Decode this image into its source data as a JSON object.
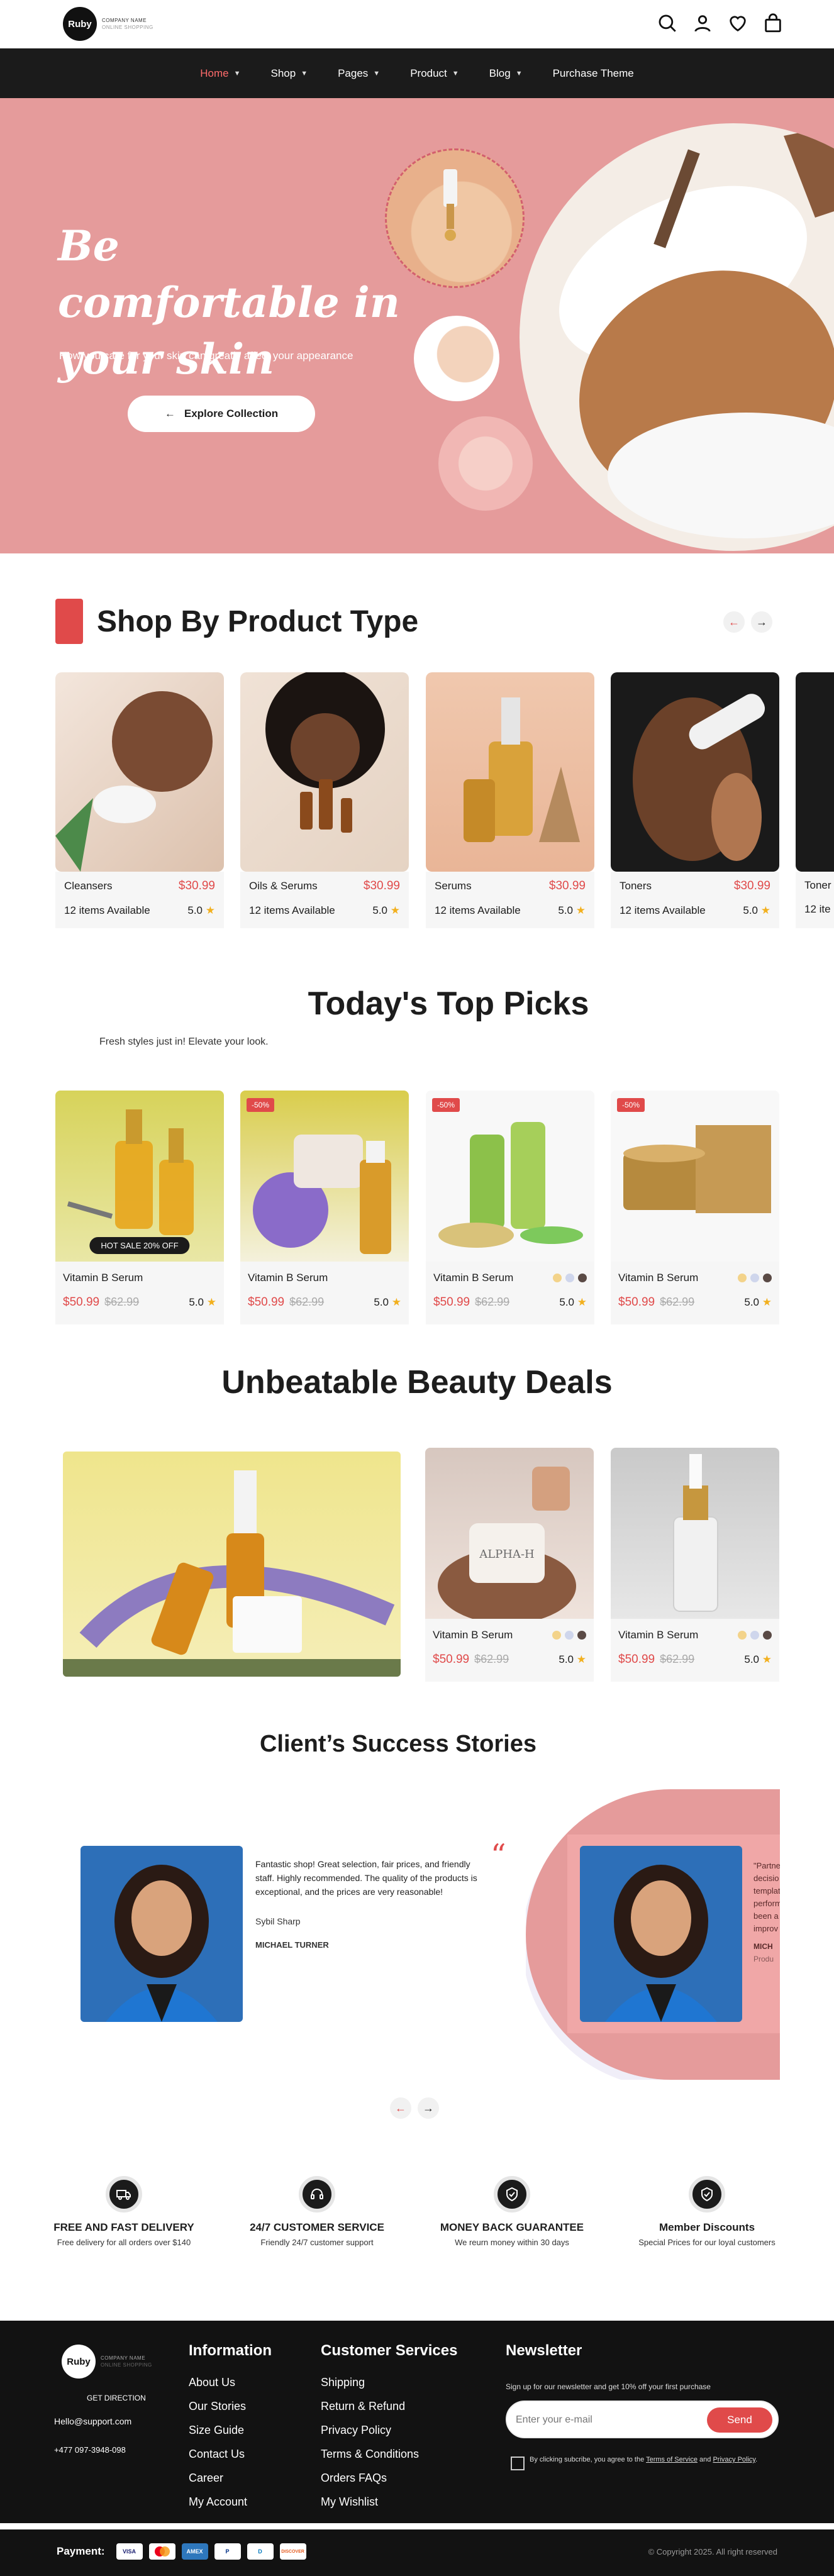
{
  "header": {
    "logo_text": "Ruby",
    "company_name": "COMPANY NAME",
    "company_tag": "ONLINE SHOPPING",
    "icons": [
      "search-icon",
      "user-icon",
      "heart-icon",
      "bag-icon"
    ]
  },
  "nav": {
    "items": [
      {
        "label": "Home",
        "active": true,
        "dropdown": true
      },
      {
        "label": "Shop",
        "dropdown": true
      },
      {
        "label": "Pages",
        "dropdown": true
      },
      {
        "label": "Product",
        "dropdown": true
      },
      {
        "label": "Blog",
        "dropdown": true
      },
      {
        "label": "Purchase Theme",
        "dropdown": false
      }
    ]
  },
  "hero": {
    "title": "Be comfortable in your skin",
    "subtitle": "How you care for your skin can greatly affect your appearance",
    "button": "Explore Collection",
    "bg_color": "#e59b9b"
  },
  "product_types": {
    "title": "Shop By Product Type",
    "items": [
      {
        "name": "Cleansers",
        "price": "$30.99",
        "available": "12 items Available",
        "rating": "5.0"
      },
      {
        "name": "Oils & Serums",
        "price": "$30.99",
        "available": "12 items Available",
        "rating": "5.0"
      },
      {
        "name": "Serums",
        "price": "$30.99",
        "available": "12 items Available",
        "rating": "5.0"
      },
      {
        "name": "Toners",
        "price": "$30.99",
        "available": "12 items Available",
        "rating": "5.0"
      },
      {
        "name": "Toner",
        "price": "",
        "available": "12 ite",
        "rating": ""
      }
    ]
  },
  "top_picks": {
    "title": "Today's Top Picks",
    "subtitle": "Fresh styles just in! Elevate your look.",
    "items": [
      {
        "name": "Vitamin B Serum",
        "price": "$50.99",
        "old_price": "$62.99",
        "rating": "5.0",
        "badge": "",
        "sale_label": "HOT SALE 20% OFF"
      },
      {
        "name": "Vitamin B Serum",
        "price": "$50.99",
        "old_price": "$62.99",
        "rating": "5.0",
        "badge": "-50%",
        "sale_label": ""
      },
      {
        "name": "Vitamin B Serum",
        "price": "$50.99",
        "old_price": "$62.99",
        "rating": "5.0",
        "badge": "-50%",
        "sale_label": ""
      },
      {
        "name": "Vitamin B Serum",
        "price": "$50.99",
        "old_price": "$62.99",
        "rating": "5.0",
        "badge": "-50%",
        "sale_label": ""
      }
    ]
  },
  "deals": {
    "title": "Unbeatable Beauty Deals",
    "items": [
      {
        "name": "Vitamin B Serum",
        "price": "$50.99",
        "old_price": "$62.99",
        "rating": "5.0",
        "brand": "ALPHA-H"
      },
      {
        "name": "Vitamin B Serum",
        "price": "$50.99",
        "old_price": "$62.99",
        "rating": "5.0"
      }
    ]
  },
  "testimonials": {
    "title": "Client’s Success Stories",
    "quote": "Fantastic shop! Great selection, fair prices, and friendly staff. Highly recommended. The quality of the products is exceptional, and the prices are very reasonable!",
    "signature": "Sybil Sharp",
    "author": "MICHAEL TURNER",
    "quote2_lines": [
      "\"Partne",
      "decisio",
      "templat",
      "perform",
      "been a",
      "improv"
    ],
    "author2": "MICH",
    "role2": "Produ"
  },
  "features": [
    {
      "title": "FREE AND FAST DELIVERY",
      "text": "Free delivery for all orders over $140",
      "icon": "truck-icon"
    },
    {
      "title": "24/7 CUSTOMER SERVICE",
      "text": "Friendly 24/7 customer support",
      "icon": "headset-icon"
    },
    {
      "title": "MONEY BACK GUARANTEE",
      "text": "We reurn money within 30 days",
      "icon": "shield-icon"
    },
    {
      "title": "Member Discounts",
      "text": "Special Prices for our loyal customers",
      "icon": "shield-check-icon"
    }
  ],
  "footer": {
    "logo_text": "Ruby",
    "company_name": "COMPANY NAME",
    "company_tag": "ONLINE SHOPPING",
    "direction": "GET DIRECTION",
    "email": "Hello@support.com",
    "phone": "+477 097-3948-098",
    "info_title": "Information",
    "info_links": [
      "About Us",
      "Our Stories",
      "Size Guide",
      "Contact Us",
      "Career",
      "My Account"
    ],
    "cs_title": "Customer Services",
    "cs_links": [
      "Shipping",
      "Return & Refund",
      "Privacy Policy",
      "Terms & Conditions",
      "Orders FAQs",
      "My Wishlist"
    ],
    "newsletter_title": "Newsletter",
    "newsletter_text": "Sign up for our newsletter and get 10% off your first purchase",
    "email_placeholder": "Enter your e-mail",
    "send": "Send",
    "consent_pre": "By clicking subcribe, you agree to the ",
    "terms": "Terms of Service",
    "and": " and ",
    "privacy": "Privacy Policy",
    "consent_end": ".",
    "payment_label": "Payment:",
    "payment_methods": [
      "VISA",
      "MC",
      "AMEX",
      "P",
      "D",
      "DISCOVER"
    ],
    "copyright": "Copyright  2025. All right reserved"
  }
}
